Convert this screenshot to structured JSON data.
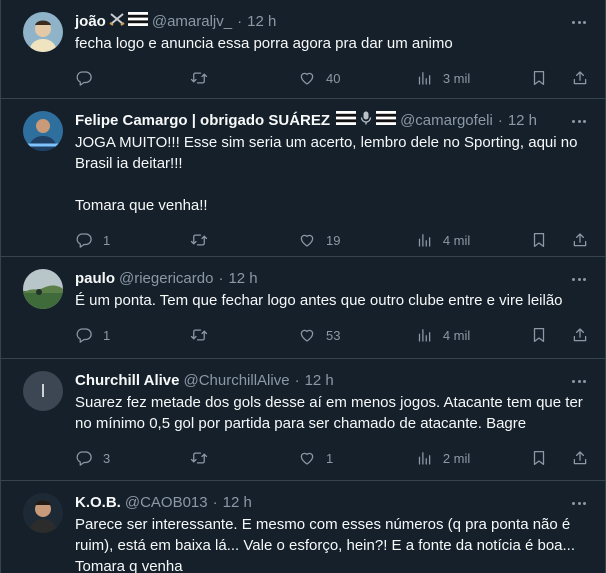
{
  "colors": {
    "background": "#15202b",
    "border": "#38444d",
    "text": "#f7f9f9",
    "muted": "#8b98a5"
  },
  "tweets": [
    {
      "name": "joão",
      "handle": "@amaraljv_",
      "time": "12 h",
      "text": "fecha logo e anuncia essa porra agora pra dar um animo",
      "replies": "",
      "retweets": "",
      "likes": "40",
      "views": "3 mil"
    },
    {
      "name": "Felipe Camargo | obrigado SUÁREZ",
      "handle": "@camargofeli",
      "time": "12 h",
      "text": "JOGA MUITO!!! Esse sim seria um acerto, lembro dele no Sporting, aqui no Brasil ia deitar!!!\n\nTomara que venha!!",
      "replies": "1",
      "retweets": "",
      "likes": "19",
      "views": "4 mil"
    },
    {
      "name": "paulo",
      "handle": "@riegericardo",
      "time": "12 h",
      "text": "É um ponta. Tem que fechar logo antes que outro clube entre e vire leilão",
      "replies": "1",
      "retweets": "",
      "likes": "53",
      "views": "4 mil"
    },
    {
      "name": "Churchill Alive",
      "handle": "@ChurchillAlive",
      "time": "12 h",
      "avatar_letter": "I",
      "text": "Suarez fez metade dos gols desse aí em menos jogos. Atacante tem que ter no mínimo 0,5 gol por partida para ser chamado de atacante. Bagre",
      "replies": "3",
      "retweets": "",
      "likes": "1",
      "views": "2 mil"
    },
    {
      "name": "K.O.B.",
      "handle": "@CAOB013",
      "time": "12 h",
      "text": "Parece ser interessante. E mesmo com esses números (q pra ponta não é ruim), está em baixa lá... Vale o esforço, hein?! E a fonte da notícia é boa... Tomara q venha",
      "replies": "",
      "retweets": "",
      "likes": "",
      "views": ""
    }
  ],
  "icons": [
    "more-icon",
    "reply-icon",
    "retweet-icon",
    "like-icon",
    "views-icon",
    "bookmark-icon",
    "share-icon",
    "flag-icon",
    "swords-icon",
    "microphone-icon"
  ]
}
